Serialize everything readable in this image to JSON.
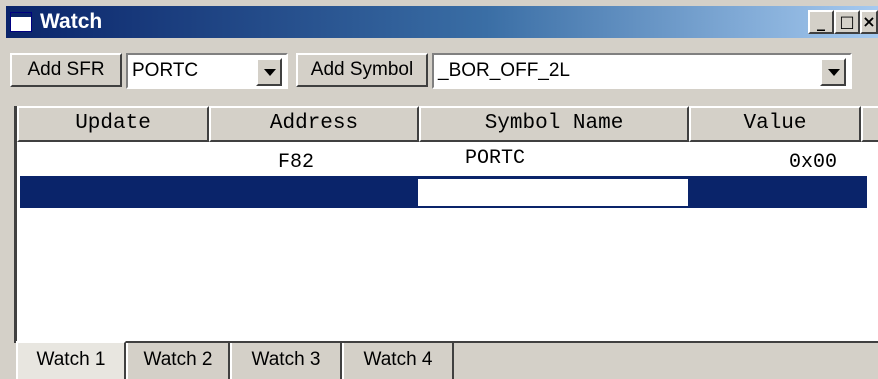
{
  "window": {
    "title": "Watch"
  },
  "title_buttons": {
    "minimize": "_",
    "maximize": "□",
    "close": "×"
  },
  "toolbar": {
    "add_sfr_label": "Add SFR",
    "sfr_selected": "PORTC",
    "add_symbol_label": "Add Symbol",
    "symbol_selected": "_BOR_OFF_2L"
  },
  "table": {
    "columns": [
      "Update",
      "Address",
      "Symbol Name",
      "Value"
    ],
    "rows": [
      {
        "update": "",
        "address": "F82",
        "symbol": "PORTC",
        "value": "0x00"
      }
    ]
  },
  "tabs": [
    "Watch 1",
    "Watch 2",
    "Watch 3",
    "Watch 4"
  ],
  "active_tab": "Watch 1",
  "colors": {
    "titlebar": "#0a246a",
    "selection": "#0a246a",
    "face": "#d4d0c8"
  }
}
